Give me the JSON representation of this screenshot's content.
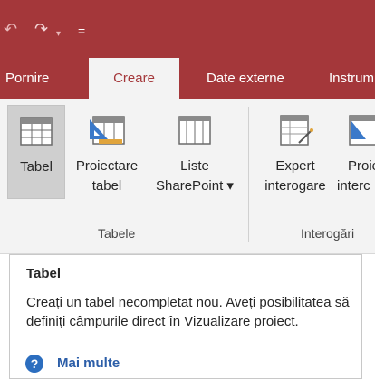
{
  "quick_access": {
    "undo_glyph": "↶",
    "redo_glyph": "↷",
    "dropdown_glyph": "▾",
    "customize_glyph": "="
  },
  "tabs": [
    {
      "label": "Pornire"
    },
    {
      "label": "Creare",
      "active": true
    },
    {
      "label": "Date externe"
    },
    {
      "label": "Instrum"
    }
  ],
  "ribbon": {
    "commands": {
      "tabel": {
        "line1": "Tabel",
        "icon": "table-icon"
      },
      "proiectare": {
        "line1": "Proiectare",
        "line2": "tabel",
        "icon": "table-design-icon"
      },
      "liste": {
        "line1": "Liste",
        "line2": "SharePoint ▾",
        "icon": "sharepoint-lists-icon"
      },
      "expert": {
        "line1": "Expert",
        "line2": "interogare",
        "icon": "query-wizard-icon"
      },
      "proie": {
        "line1": "Proie",
        "line2": "interc",
        "icon": "query-design-icon"
      }
    },
    "groups": {
      "tabele": "Tabele",
      "interogari": "Interogări"
    }
  },
  "tooltip": {
    "title": "Tabel",
    "body": "Creați un tabel necompletat nou. Aveți posibilitatea să definiți câmpurile direct în Vizualizare proiect.",
    "more": "Mai multe",
    "help_glyph": "?"
  },
  "colors": {
    "accent": "#a4373a",
    "ribbon_bg": "#f3f3f3",
    "link": "#2c5ea8"
  }
}
